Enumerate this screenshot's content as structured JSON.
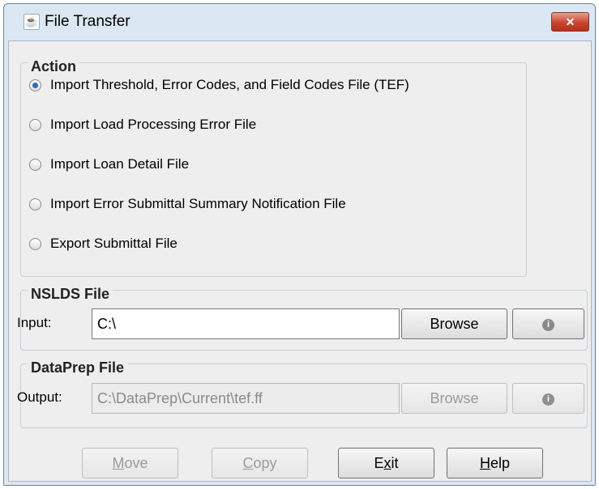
{
  "window": {
    "title": "File Transfer",
    "close_symbol": "✕",
    "app_icon": "java-cup-icon"
  },
  "action": {
    "legend": "Action",
    "options": [
      {
        "label": "Import Threshold, Error Codes, and Field Codes File (TEF)",
        "selected": true
      },
      {
        "label": "Import Load Processing Error File",
        "selected": false
      },
      {
        "label": "Import Loan Detail File",
        "selected": false
      },
      {
        "label": "Import Error Submittal Summary Notification File",
        "selected": false
      },
      {
        "label": "Export Submittal File",
        "selected": false
      }
    ]
  },
  "nslds": {
    "legend": "NSLDS File",
    "input_label": "Input:",
    "input_value": "C:\\",
    "browse_label": "Browse",
    "info_icon": "info-icon"
  },
  "dataprep": {
    "legend": "DataPrep File",
    "output_label": "Output:",
    "output_value": "C:\\DataPrep\\Current\\tef.ff",
    "browse_label": "Browse",
    "info_icon": "info-icon"
  },
  "buttons": {
    "move": {
      "label": "Move",
      "mnemonic": "M",
      "rest": "ove"
    },
    "copy": {
      "label": "Copy",
      "mnemonic": "C",
      "rest": "opy"
    },
    "exit": {
      "label": "Exit",
      "pre": "E",
      "mnemonic": "x",
      "rest": "it"
    },
    "help": {
      "label": "Help",
      "mnemonic": "H",
      "rest": "elp"
    }
  }
}
